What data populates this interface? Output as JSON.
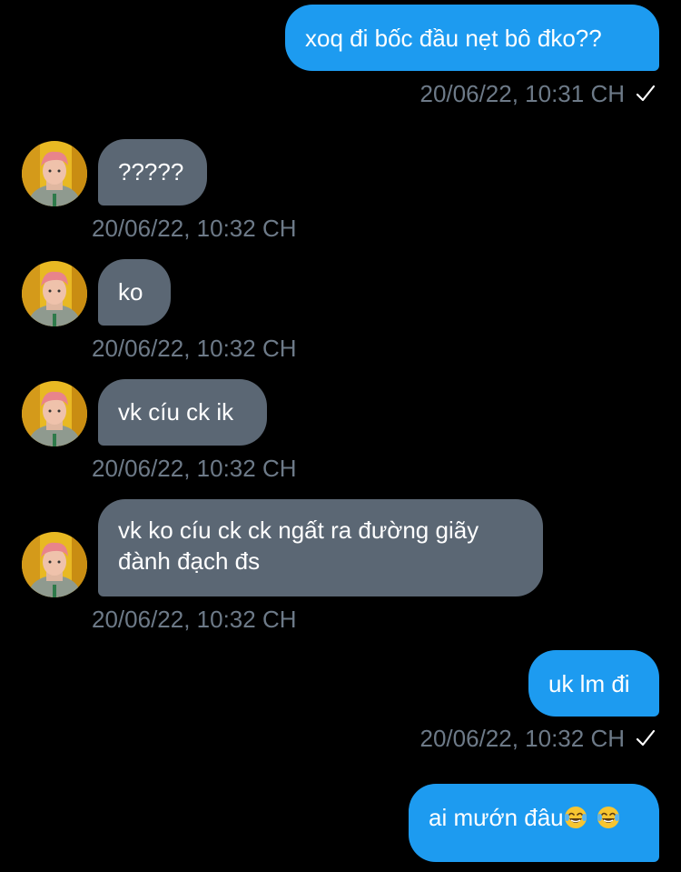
{
  "messages": [
    {
      "direction": "out",
      "text": "xoq đi bốc đầu nẹt bô đko??",
      "timestamp": "20/06/22, 10:31 CH",
      "status": "sent-check-icon"
    },
    {
      "direction": "in",
      "text": "?????",
      "timestamp": "20/06/22, 10:32 CH"
    },
    {
      "direction": "in",
      "text": "ko",
      "timestamp": "20/06/22, 10:32 CH"
    },
    {
      "direction": "in",
      "text": "vk cíu ck ik",
      "timestamp": "20/06/22, 10:32 CH"
    },
    {
      "direction": "in",
      "text_line1": "vk ko cíu ck ck ngất ra đường giãy",
      "text_line2": "đành đạch đs",
      "timestamp": "20/06/22, 10:32 CH"
    },
    {
      "direction": "out",
      "text": "uk lm đi",
      "timestamp": "20/06/22, 10:32 CH",
      "status": "sent-check-icon"
    },
    {
      "direction": "out",
      "text": "ai mướn đâu",
      "emojis": [
        "face-with-tears-of-joy-icon",
        "face-with-tears-of-joy-icon"
      ]
    }
  ],
  "colors": {
    "background": "#000000",
    "outgoing_bubble": "#1d9bf0",
    "incoming_bubble": "#5b6774",
    "timestamp": "#6d7a88",
    "text": "#ffffff"
  },
  "icons": {
    "avatar": "contact-avatar",
    "check": "check-icon",
    "emoji": "face-with-tears-of-joy-icon"
  }
}
